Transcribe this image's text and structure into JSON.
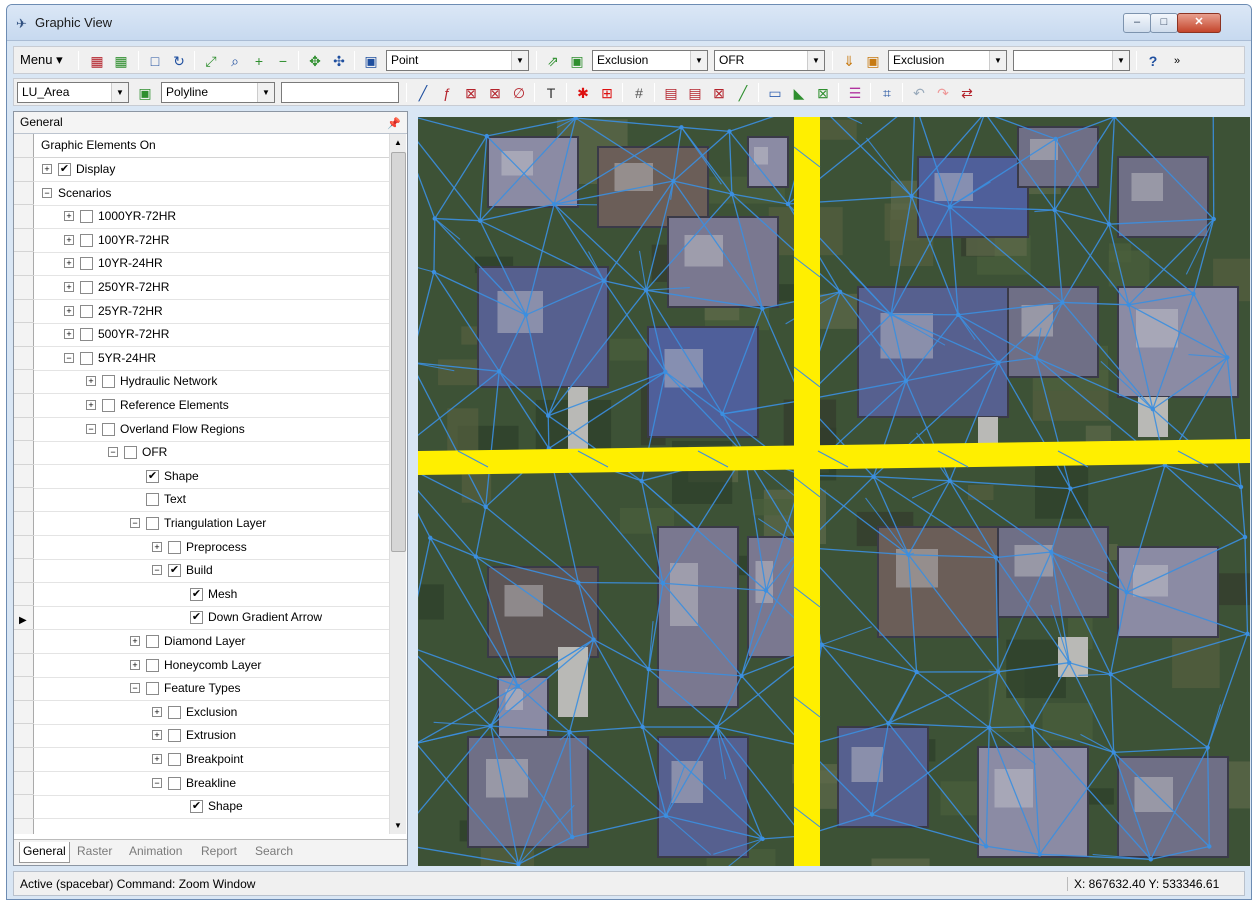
{
  "window": {
    "title": "Graphic View",
    "minimize": "–",
    "maximize": "□",
    "close": "✕"
  },
  "toolbar1": {
    "menu_label": "Menu",
    "point_combo": "Point",
    "exclusion_combo_1": "Exclusion",
    "ofr_combo": "OFR",
    "exclusion_combo_2": "Exclusion",
    "empty_combo": "",
    "help": "?"
  },
  "toolbar2": {
    "layer_combo": "LU_Area",
    "shape_combo": "Polyline",
    "text_field": ""
  },
  "panel": {
    "title": "General",
    "tree_header": "Graphic Elements On",
    "tree": [
      {
        "label": "Display",
        "depth": 0,
        "expander": "+",
        "checked": "✔"
      },
      {
        "label": "Scenarios",
        "depth": 0,
        "expander": "−",
        "checked": null
      },
      {
        "label": "1000YR-72HR",
        "depth": 1,
        "expander": "+",
        "checked": ""
      },
      {
        "label": "100YR-72HR",
        "depth": 1,
        "expander": "+",
        "checked": ""
      },
      {
        "label": "10YR-24HR",
        "depth": 1,
        "expander": "+",
        "checked": ""
      },
      {
        "label": "250YR-72HR",
        "depth": 1,
        "expander": "+",
        "checked": ""
      },
      {
        "label": "25YR-72HR",
        "depth": 1,
        "expander": "+",
        "checked": ""
      },
      {
        "label": "500YR-72HR",
        "depth": 1,
        "expander": "+",
        "checked": ""
      },
      {
        "label": "5YR-24HR",
        "depth": 1,
        "expander": "−",
        "checked": ""
      },
      {
        "label": "Hydraulic Network",
        "depth": 2,
        "expander": "+",
        "checked": ""
      },
      {
        "label": "Reference Elements",
        "depth": 2,
        "expander": "+",
        "checked": ""
      },
      {
        "label": "Overland Flow Regions",
        "depth": 2,
        "expander": "−",
        "checked": ""
      },
      {
        "label": "OFR",
        "depth": 3,
        "expander": "−",
        "checked": ""
      },
      {
        "label": "Shape",
        "depth": 4,
        "expander": null,
        "checked": "✔"
      },
      {
        "label": "Text",
        "depth": 4,
        "expander": null,
        "checked": ""
      },
      {
        "label": "Triangulation Layer",
        "depth": 4,
        "expander": "−",
        "checked": ""
      },
      {
        "label": "Preprocess",
        "depth": 5,
        "expander": "+",
        "checked": ""
      },
      {
        "label": "Build",
        "depth": 5,
        "expander": "−",
        "checked": "✔"
      },
      {
        "label": "Mesh",
        "depth": 6,
        "expander": null,
        "checked": "✔"
      },
      {
        "label": "Down Gradient Arrow",
        "depth": 6,
        "expander": null,
        "checked": "✔"
      },
      {
        "label": "Diamond Layer",
        "depth": 4,
        "expander": "+",
        "checked": ""
      },
      {
        "label": "Honeycomb Layer",
        "depth": 4,
        "expander": "+",
        "checked": ""
      },
      {
        "label": "Feature Types",
        "depth": 4,
        "expander": "−",
        "checked": ""
      },
      {
        "label": "Exclusion",
        "depth": 5,
        "expander": "+",
        "checked": ""
      },
      {
        "label": "Extrusion",
        "depth": 5,
        "expander": "+",
        "checked": ""
      },
      {
        "label": "Breakpoint",
        "depth": 5,
        "expander": "+",
        "checked": ""
      },
      {
        "label": "Breakline",
        "depth": 5,
        "expander": "−",
        "checked": ""
      },
      {
        "label": "Shape",
        "depth": 6,
        "expander": null,
        "checked": "✔"
      }
    ],
    "tabs": {
      "general": "General",
      "raster": "Raster",
      "animation": "Animation",
      "report": "Report",
      "search": "Search"
    }
  },
  "status": {
    "command": "Active (spacebar) Command: Zoom Window",
    "coords": "X: 867632.40  Y: 533346.61"
  },
  "colors": {
    "road": "#ffef00",
    "mesh": "#3b8fe0",
    "titlebar": "#c7d9ef",
    "close_button": "#c4452c"
  },
  "icons": [
    "grid-icon",
    "rectangle-icon",
    "refresh-icon",
    "zoom-extents-icon",
    "zoom-in-icon",
    "zoom-out-icon",
    "pan-icon",
    "help-icon",
    "pin-icon"
  ]
}
